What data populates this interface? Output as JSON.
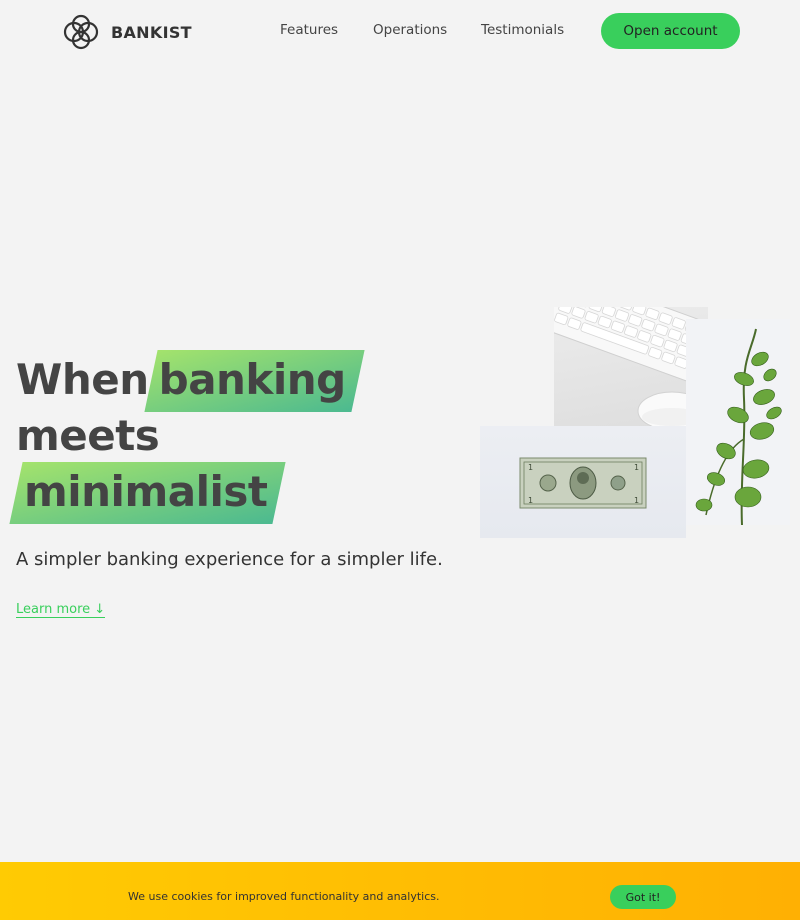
{
  "nav": {
    "logo_text": "BANKIST",
    "links": [
      "Features",
      "Operations",
      "Testimonials"
    ],
    "cta_label": "Open account"
  },
  "hero": {
    "title_word_1": "When",
    "title_highlight_1": "banking",
    "title_word_2": "meets",
    "title_highlight_2": "minimalist",
    "subtitle": "A simpler banking experience for a simpler life.",
    "learn_more": "Learn more ↓",
    "images": [
      "keyboard-and-mouse-image",
      "dollar-bill-image",
      "plant-image"
    ]
  },
  "cookie": {
    "message": "We use cookies for improved functionality and analytics.",
    "button_label": "Got it!"
  },
  "colors": {
    "background": "#f3f3f3",
    "accent_green": "#39cf5c",
    "highlight_gradient_start": "#9be15d",
    "highlight_gradient_end": "#39b385",
    "cookie_bar": "#ffcb03"
  }
}
